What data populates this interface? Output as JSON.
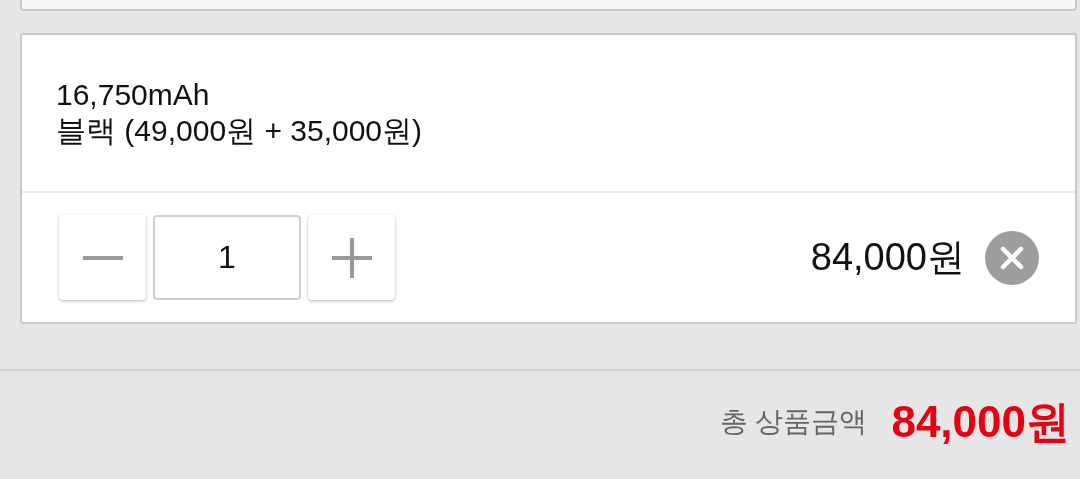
{
  "option": {
    "name": "16,750mAh",
    "detail": "블랙 (49,000원 + 35,000원)"
  },
  "quantity": {
    "value": "1",
    "price": "84,000원"
  },
  "total": {
    "label": "총 상품금액",
    "amount": "84,000원"
  }
}
